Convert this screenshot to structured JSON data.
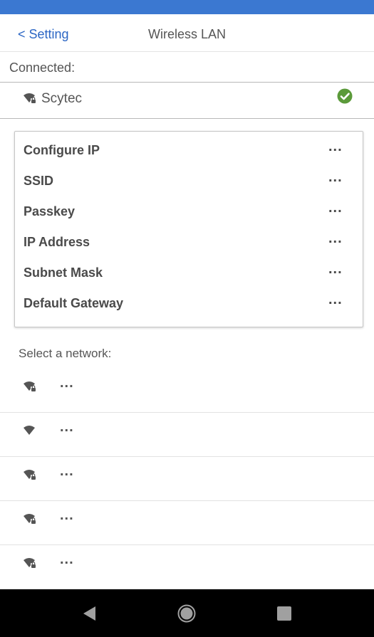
{
  "status_bar": {
    "color": "#3b78d1"
  },
  "header": {
    "back_label": "< Setting",
    "title": "Wireless LAN"
  },
  "connected": {
    "section_label": "Connected:",
    "network_name": "Scytec",
    "status_icon": "check-circle-icon",
    "status_color": "#5b9a3a"
  },
  "info_card": {
    "rows": [
      {
        "label": "Configure IP",
        "value": "..."
      },
      {
        "label": "SSID",
        "value": "..."
      },
      {
        "label": "Passkey",
        "value": "..."
      },
      {
        "label": "IP Address",
        "value": "..."
      },
      {
        "label": "Subnet Mask",
        "value": "..."
      },
      {
        "label": "Default Gateway",
        "value": "..."
      }
    ]
  },
  "networks": {
    "section_label": "Select a network:",
    "items": [
      {
        "name": "...",
        "icon": "wifi-lock-icon"
      },
      {
        "name": "...",
        "icon": "wifi-icon"
      },
      {
        "name": "...",
        "icon": "wifi-lock-icon"
      },
      {
        "name": "...",
        "icon": "wifi-lock-icon"
      },
      {
        "name": "...",
        "icon": "wifi-lock-icon"
      }
    ]
  },
  "nav_bar": {
    "buttons": [
      "back-icon",
      "home-icon",
      "recents-icon"
    ]
  }
}
